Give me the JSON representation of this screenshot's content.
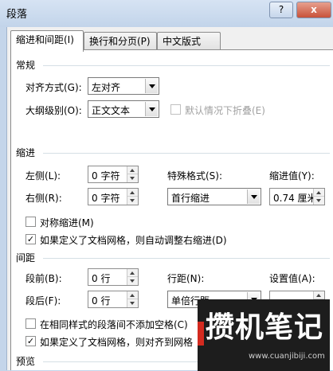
{
  "window": {
    "title": "段落",
    "help_label": "?",
    "close_label": "x"
  },
  "tabs": [
    {
      "label": "缩进和间距(I)",
      "active": true
    },
    {
      "label": "换行和分页(P)",
      "active": false
    },
    {
      "label": "中文版式(H)",
      "active": false
    }
  ],
  "general": {
    "heading": "常规",
    "alignment_label": "对齐方式(G):",
    "alignment_value": "左对齐",
    "outline_label": "大纲级别(O):",
    "outline_value": "正文文本",
    "collapse_label": "默认情况下折叠(E)",
    "collapse_checked": false
  },
  "indent": {
    "heading": "缩进",
    "left_label": "左侧(L):",
    "left_value": "0 字符",
    "right_label": "右侧(R):",
    "right_value": "0 字符",
    "special_label": "特殊格式(S):",
    "special_value": "首行缩进",
    "by_label": "缩进值(Y):",
    "by_value": "0.74 厘米",
    "mirror_label": "对称缩进(M)",
    "mirror_checked": false,
    "auto_adjust_label": "如果定义了文档网格，则自动调整右缩进(D)",
    "auto_adjust_checked": true
  },
  "spacing": {
    "heading": "间距",
    "before_label": "段前(B):",
    "before_value": "0 行",
    "after_label": "段后(F):",
    "after_value": "0 行",
    "line_label": "行距(N):",
    "line_value": "单倍行距",
    "at_label": "设置值(A):",
    "at_value": "",
    "no_space_label": "在相同样式的段落间不添加空格(C)",
    "no_space_checked": false,
    "snap_grid_label": "如果定义了文档网格，则对齐到网格",
    "snap_grid_checked": true
  },
  "preview": {
    "heading": "预览"
  },
  "watermark": {
    "text": "攒机笔记",
    "url": "www.cuanjibiji.com"
  }
}
